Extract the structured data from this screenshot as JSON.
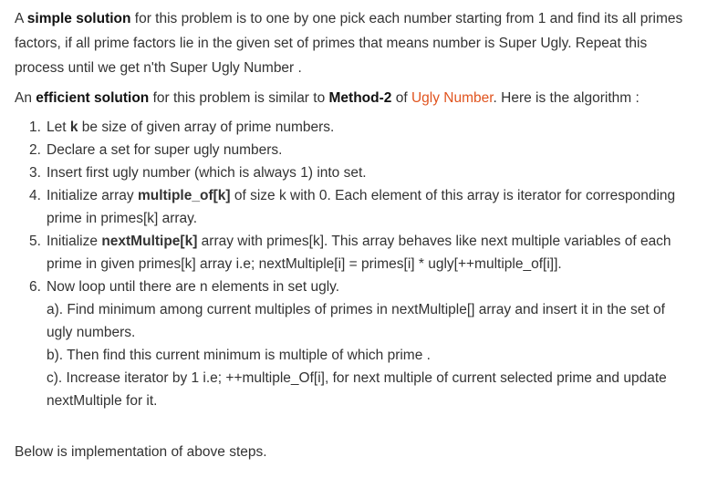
{
  "intro": {
    "p1_a": "A ",
    "p1_bold": "simple solution",
    "p1_rest_line1": " for this problem is to one by one pick each number starting from 1 and find its all primes",
    "p1_line2": "factors, if all prime factors lie in the given set of primes that means number is Super Ugly. Repeat this",
    "p1_line3": "process until we get n'th Super Ugly Number ."
  },
  "efficient": {
    "a": "An ",
    "bold1": "efficient solution",
    "b": " for this problem is similar to ",
    "bold2": "Method-2",
    "c": " of ",
    "link": "Ugly Number",
    "d": ". Here is the algorithm :"
  },
  "steps": [
    {
      "num": "1.",
      "a": "Let ",
      "bold": "k",
      "b": " be size of given array of prime numbers."
    },
    {
      "num": "2.",
      "text": "Declare a set for super ugly numbers."
    },
    {
      "num": "3.",
      "text": "Insert first ugly number (which is always 1) into set."
    },
    {
      "num": "4.",
      "a": "Initialize array ",
      "bold": "multiple_of[k]",
      "b": " of size k with 0. Each element of this array is iterator for corresponding",
      "line2": "prime in primes[k] array."
    },
    {
      "num": "5.",
      "a": "Initialize ",
      "bold": "nextMultipe[k]",
      "b": " array with primes[k]. This array behaves like next multiple variables of each",
      "line2": "prime in given primes[k] array i.e; nextMultiple[i] = primes[i] * ugly[++multiple_of[i]]."
    },
    {
      "num": "6.",
      "text": "Now loop until there are n elements in set ugly."
    }
  ],
  "substeps": [
    {
      "line1": "a). Find minimum among current multiples of primes in nextMultiple[] array and insert it in the set of",
      "line2": "ugly numbers."
    },
    {
      "line1": "b). Then find this current minimum is multiple of which prime ."
    },
    {
      "line1": "c). Increase iterator by 1 i.e; ++multiple_Of[i], for next multiple of current selected prime and update",
      "line2": "nextMultiple for it."
    }
  ],
  "outro": "Below is implementation of above steps."
}
